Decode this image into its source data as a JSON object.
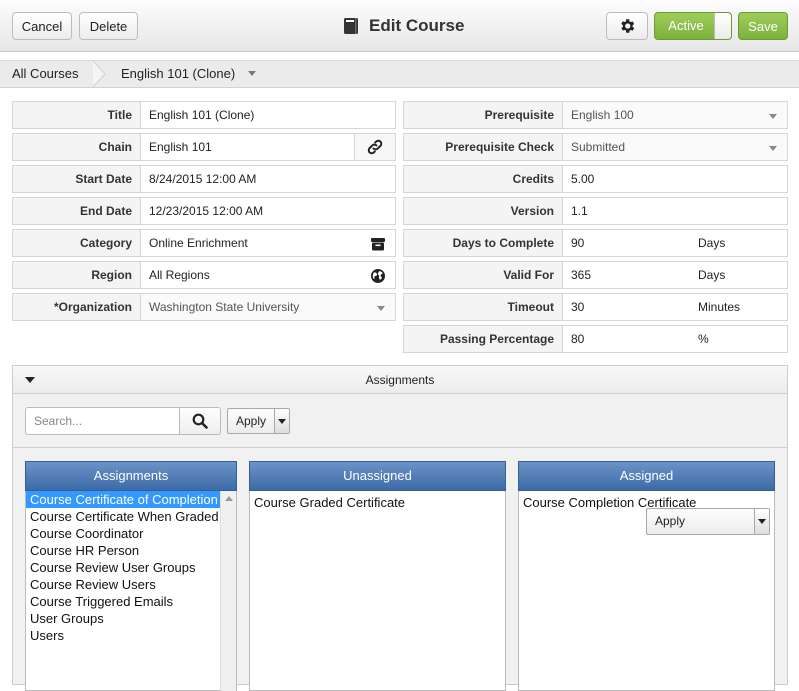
{
  "toolbar": {
    "cancel_label": "Cancel",
    "delete_label": "Delete",
    "title": "Edit Course",
    "active_label": "Active",
    "save_label": "Save"
  },
  "breadcrumb": {
    "root": "All Courses",
    "current": "English 101 (Clone)"
  },
  "form_left": {
    "title": {
      "label": "Title",
      "value": "English 101 (Clone)"
    },
    "chain": {
      "label": "Chain",
      "value": "English 101"
    },
    "start_date": {
      "label": "Start Date",
      "value": "8/24/2015 12:00 AM"
    },
    "end_date": {
      "label": "End Date",
      "value": "12/23/2015 12:00 AM"
    },
    "category": {
      "label": "Category",
      "value": "Online Enrichment"
    },
    "region": {
      "label": "Region",
      "value": "All Regions"
    },
    "organization": {
      "label": "*Organization",
      "value": "Washington State University"
    }
  },
  "form_right": {
    "prerequisite": {
      "label": "Prerequisite",
      "value": "English 100"
    },
    "prerequisite_check": {
      "label": "Prerequisite Check",
      "value": "Submitted"
    },
    "credits": {
      "label": "Credits",
      "value": "5.00"
    },
    "version": {
      "label": "Version",
      "value": "1.1"
    },
    "days_to_complete": {
      "label": "Days to Complete",
      "value": "90",
      "unit": "Days"
    },
    "valid_for": {
      "label": "Valid For",
      "value": "365",
      "unit": "Days"
    },
    "timeout": {
      "label": "Timeout",
      "value": "30",
      "unit": "Minutes"
    },
    "passing_percentage": {
      "label": "Passing Percentage",
      "value": "80",
      "unit": "%"
    }
  },
  "assignments": {
    "panel_title": "Assignments",
    "search_placeholder": "Search...",
    "apply_label": "Apply",
    "columns": {
      "assignments": {
        "header": "Assignments",
        "items": [
          "Course Certificate of Completion",
          "Course Certificate When Graded",
          "Course Coordinator",
          "Course HR Person",
          "Course Review User Groups",
          "Course Review Users",
          "Course Triggered Emails",
          "User Groups",
          "Users"
        ],
        "selected_index": 0
      },
      "unassigned": {
        "header": "Unassigned",
        "items": [
          "Course Graded Certificate"
        ]
      },
      "assigned": {
        "header": "Assigned",
        "items": [
          "Course Completion Certificate"
        ],
        "apply_label": "Apply"
      }
    }
  },
  "colors": {
    "accent_green": "#8cbf4a",
    "column_header_blue": "#4a76b0",
    "selection_blue": "#3399ff"
  },
  "icons": [
    "book-icon",
    "gear-icon",
    "link-icon",
    "archive-icon",
    "globe-icon",
    "search-icon"
  ]
}
